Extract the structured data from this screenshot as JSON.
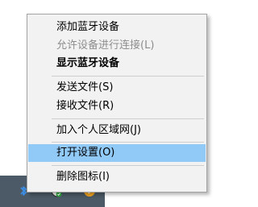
{
  "context_menu": {
    "items": [
      {
        "label": "添加蓝牙设备",
        "state": "normal"
      },
      {
        "label": "允许设备进行连接(L)",
        "state": "disabled"
      },
      {
        "label": "显示蓝牙设备",
        "state": "bold"
      },
      {
        "label": "发送文件(S)",
        "state": "normal"
      },
      {
        "label": "接收文件(R)",
        "state": "normal"
      },
      {
        "label": "加入个人区域网(J)",
        "state": "normal"
      },
      {
        "label": "打开设置(O)",
        "state": "selected"
      },
      {
        "label": "删除图标(I)",
        "state": "normal"
      }
    ],
    "highlight_color": "#91c9f7"
  },
  "taskbar": {
    "color": "#4b5a66",
    "tray_icons": [
      "bluetooth-icon",
      "security-shield-icon",
      "update-shield-icon"
    ]
  }
}
